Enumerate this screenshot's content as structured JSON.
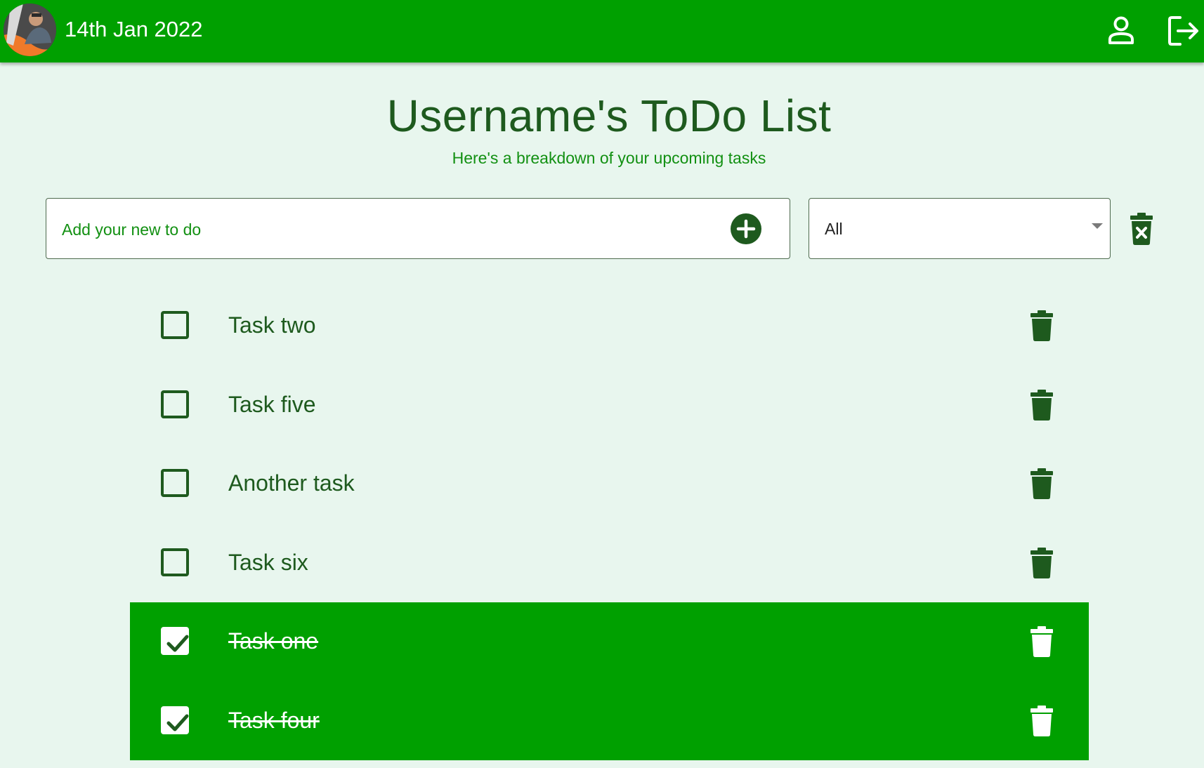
{
  "header": {
    "date": "14th Jan 2022",
    "avatar_icon": "user-photo-avatar",
    "profile_icon": "person-icon",
    "logout_icon": "logout-icon",
    "background_color": "#00a000"
  },
  "page": {
    "title": "Username's ToDo List",
    "subtitle": "Here's a breakdown of your upcoming tasks"
  },
  "new_todo": {
    "placeholder": "Add your new to do",
    "value": "",
    "add_icon": "plus-circle-icon"
  },
  "filter": {
    "selected": "All"
  },
  "clear_completed_icon": "trash-x-icon",
  "tasks": [
    {
      "label": "Task two",
      "completed": false
    },
    {
      "label": "Task five",
      "completed": false
    },
    {
      "label": "Another task",
      "completed": false
    },
    {
      "label": "Task six",
      "completed": false
    },
    {
      "label": "Task one",
      "completed": true
    },
    {
      "label": "Task four",
      "completed": true
    }
  ],
  "colors": {
    "accent": "#00a000",
    "text_dark": "#1e5a1e",
    "text_green": "#129012",
    "page_background": "#e8f6ee"
  }
}
